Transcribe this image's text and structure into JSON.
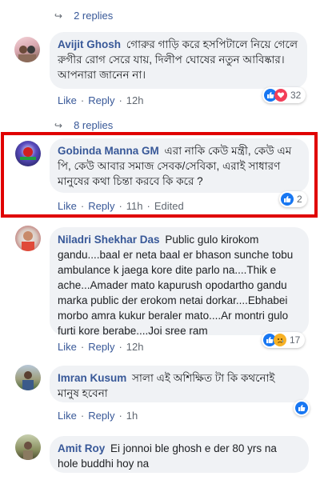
{
  "comments": [
    {
      "author": "Avijit Ghosh",
      "text": "গোরুর গাড়ি করে হসপিটালে নিয়ে গেলে রুগীর রোগ সেরে যায়, দিলীপ ঘোষের নতুন আবিষ্কার। আপনারা জানেন না।",
      "time": "12h",
      "reactions": "32",
      "reaction_icons": [
        "like-icon",
        "love-icon"
      ]
    },
    {
      "author": "Gobinda Manna GM",
      "text": "এরা নাকি কেউ মন্ত্রী, কেউ এম পি, কেউ আবার সমাজ সেবক/সেবিকা, এরাই সাধারণ মানুষের কথা চিন্তা করবে কি করে ?",
      "time": "11h",
      "edited": "Edited",
      "reactions": "2",
      "reaction_icons": [
        "like-icon"
      ]
    },
    {
      "author": "Niladri Shekhar Das",
      "text": "Public gulo kirokom gandu....baal er neta baal er bhason sunche tobu ambulance k jaega kore dite parlo na....Thik e ache...Amader mato kapurush opodartho gandu marka public der erokom netai dorkar....Ebhabei morbo amra kukur beraler mato....Ar montri gulo furti kore berabe....Joi sree ram",
      "time": "12h",
      "reactions": "17",
      "reaction_icons": [
        "like-icon",
        "sad-icon"
      ]
    },
    {
      "author": "Imran Kusum",
      "text": "সালা এই অশিক্ষিত টা কি কথনোই মানুষ হবেনা",
      "time": "1h",
      "reaction_icons": [
        "like-icon"
      ]
    },
    {
      "author": "Amit Roy",
      "text": "Ei jonnoi ble ghosh e der 80 yrs na hole buddhi hoy na"
    }
  ],
  "replies_top": "2 replies",
  "replies_mid": "8 replies",
  "like_label": "Like",
  "reply_label": "Reply",
  "separator": "·",
  "colors": {
    "link": "#385898",
    "bubble": "#f0f2f5",
    "highlight": "#e00000",
    "like": "#1877f2"
  }
}
